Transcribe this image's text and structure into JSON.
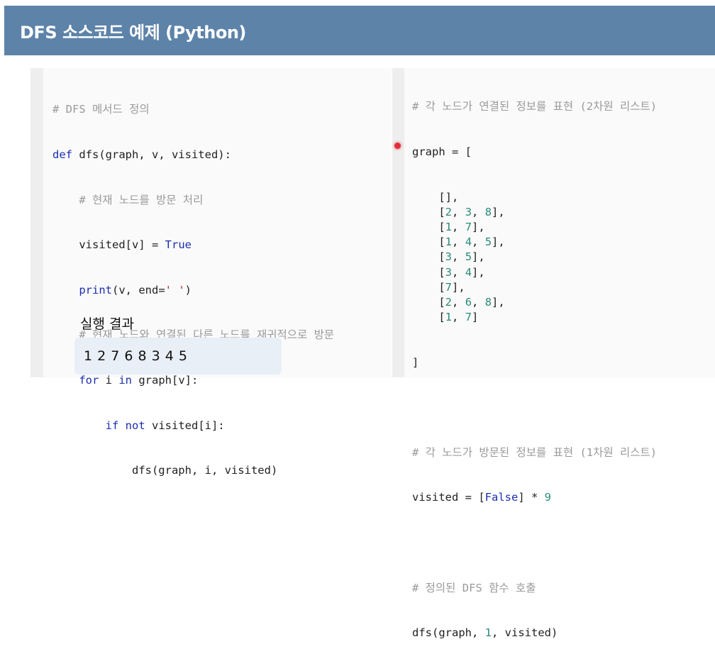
{
  "header": {
    "title": "DFS 소스코드 예제 (Python)"
  },
  "left_code": {
    "l1": "# DFS 메서드 정의",
    "l2_kw": "def",
    "l2_rest": " dfs(graph, v, visited):",
    "l3_indent": "    ",
    "l3": "# 현재 노드를 방문 처리",
    "l4_indent": "    ",
    "l4_a": "visited[v] = ",
    "l4_kw": "True",
    "l5_indent": "    ",
    "l5_kw": "print",
    "l5_a": "(v, end=",
    "l5_str": "' '",
    "l5_b": ")",
    "l6_indent": "    ",
    "l6": "# 현재 노드와 연결된 다른 노드를 재귀적으로 방문",
    "l7_indent": "    ",
    "l7_kw1": "for",
    "l7_a": " i ",
    "l7_kw2": "in",
    "l7_b": " graph[v]:",
    "l8_indent": "        ",
    "l8_kw1": "if",
    "l8_a": " ",
    "l8_kw2": "not",
    "l8_b": " visited[i]:",
    "l9_indent": "            ",
    "l9": "dfs(graph, i, visited)"
  },
  "result": {
    "title": "실행 결과",
    "output": "1 2 7 6 8 3 4 5"
  },
  "right_code": {
    "c1": "# 각 노드가 연결된 정보를 표현 (2차원 리스트)",
    "graph_open": "graph = [",
    "rows": [
      {
        "pre": "    [",
        "nums": [],
        "post": "],"
      },
      {
        "pre": "    [",
        "nums": [
          "2",
          "3",
          "8"
        ],
        "post": "],"
      },
      {
        "pre": "    [",
        "nums": [
          "1",
          "7"
        ],
        "post": "],"
      },
      {
        "pre": "    [",
        "nums": [
          "1",
          "4",
          "5"
        ],
        "post": "],"
      },
      {
        "pre": "    [",
        "nums": [
          "3",
          "5"
        ],
        "post": "],"
      },
      {
        "pre": "    [",
        "nums": [
          "3",
          "4"
        ],
        "post": "],"
      },
      {
        "pre": "    [",
        "nums": [
          "7"
        ],
        "post": "],"
      },
      {
        "pre": "    [",
        "nums": [
          "2",
          "6",
          "8"
        ],
        "post": "],"
      },
      {
        "pre": "    [",
        "nums": [
          "1",
          "7"
        ],
        "post": "]"
      }
    ],
    "graph_close": "]",
    "c2": "# 각 노드가 방문된 정보를 표현 (1차원 리스트)",
    "v_a": "visited = [",
    "v_kw": "False",
    "v_b": "] * ",
    "v_num": "9",
    "c3": "# 정의된 DFS 함수 호출",
    "call_a": "dfs(graph, ",
    "call_num": "1",
    "call_b": ", visited)"
  },
  "colors": {
    "header_bg": "#5d83a9",
    "keyword": "#1b2fb0",
    "comment": "#9a9a9a",
    "number": "#2a8a7a",
    "result_bg": "#e8eff6",
    "cursor": "#e0303a"
  }
}
